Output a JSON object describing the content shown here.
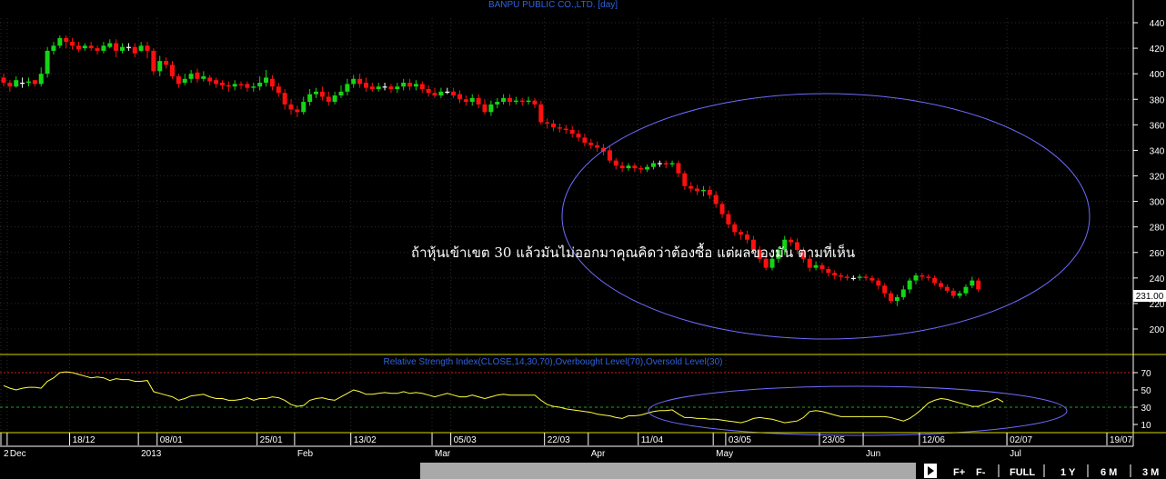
{
  "chart_data": {
    "type": "candlestick",
    "title": "BANPU PUBLIC CO.,LTD. [day]",
    "y_ticks": [
      200,
      220,
      240,
      260,
      280,
      300,
      320,
      340,
      360,
      380,
      400,
      420,
      440
    ],
    "ylim": [
      185,
      452
    ],
    "last_price": "231.00",
    "colors": {
      "up": "#16d416",
      "down": "#ff1010",
      "doji": "#ffffff"
    },
    "candles": [
      [
        397,
        393,
        400,
        390
      ],
      [
        393,
        390,
        395,
        386
      ],
      [
        390,
        395,
        398,
        389
      ],
      [
        393,
        393,
        397,
        389
      ],
      [
        393,
        394,
        397,
        390
      ],
      [
        395,
        392,
        395,
        390
      ],
      [
        392,
        400,
        405,
        390
      ],
      [
        400,
        418,
        421,
        397
      ],
      [
        418,
        422,
        425,
        415
      ],
      [
        422,
        428,
        430,
        420
      ],
      [
        428,
        425,
        430,
        420
      ],
      [
        425,
        422,
        428,
        419
      ],
      [
        422,
        419,
        425,
        417
      ],
      [
        420,
        422,
        424,
        418
      ],
      [
        422,
        420,
        425,
        418
      ],
      [
        420,
        418,
        422,
        415
      ],
      [
        418,
        422,
        425,
        416
      ],
      [
        421,
        424,
        427,
        420
      ],
      [
        424,
        418,
        427,
        413
      ],
      [
        418,
        421,
        424,
        416
      ],
      [
        421,
        421,
        424,
        418
      ],
      [
        421,
        416,
        424,
        413
      ],
      [
        418,
        422,
        425,
        417
      ],
      [
        422,
        418,
        425,
        412
      ],
      [
        418,
        402,
        420,
        399
      ],
      [
        402,
        410,
        414,
        398
      ],
      [
        410,
        407,
        413,
        404
      ],
      [
        407,
        398,
        410,
        396
      ],
      [
        398,
        392,
        400,
        389
      ],
      [
        393,
        396,
        400,
        391
      ],
      [
        396,
        400,
        403,
        393
      ],
      [
        401,
        396,
        404,
        393
      ],
      [
        396,
        398,
        402,
        394
      ],
      [
        397,
        394,
        399,
        391
      ],
      [
        395,
        392,
        397,
        389
      ],
      [
        393,
        391,
        395,
        388
      ],
      [
        391,
        390,
        394,
        386
      ],
      [
        390,
        392,
        395,
        387
      ],
      [
        392,
        391,
        394,
        388
      ],
      [
        392,
        389,
        394,
        386
      ],
      [
        389,
        390,
        393,
        386
      ],
      [
        390,
        393,
        398,
        387
      ],
      [
        393,
        397,
        403,
        390
      ],
      [
        396,
        390,
        399,
        387
      ],
      [
        390,
        385,
        393,
        382
      ],
      [
        385,
        376,
        388,
        372
      ],
      [
        376,
        372,
        380,
        368
      ],
      [
        372,
        370,
        375,
        366
      ],
      [
        370,
        378,
        382,
        368
      ],
      [
        378,
        384,
        388,
        375
      ],
      [
        384,
        386,
        389,
        381
      ],
      [
        386,
        382,
        390,
        379
      ],
      [
        382,
        378,
        386,
        375
      ],
      [
        378,
        383,
        386,
        376
      ],
      [
        383,
        386,
        391,
        381
      ],
      [
        386,
        392,
        396,
        383
      ],
      [
        392,
        396,
        399,
        389
      ],
      [
        396,
        392,
        400,
        389
      ],
      [
        393,
        389,
        397,
        386
      ],
      [
        390,
        388,
        393,
        386
      ],
      [
        388,
        390,
        393,
        386
      ],
      [
        390,
        390,
        393,
        387
      ],
      [
        390,
        388,
        392,
        385
      ],
      [
        388,
        390,
        393,
        385
      ],
      [
        390,
        393,
        396,
        387
      ],
      [
        393,
        390,
        396,
        387
      ],
      [
        390,
        392,
        395,
        387
      ],
      [
        392,
        388,
        394,
        385
      ],
      [
        388,
        385,
        391,
        382
      ],
      [
        385,
        383,
        389,
        381
      ],
      [
        383,
        386,
        389,
        381
      ],
      [
        386,
        386,
        389,
        384
      ],
      [
        386,
        383,
        389,
        381
      ],
      [
        384,
        380,
        387,
        377
      ],
      [
        380,
        378,
        383,
        375
      ],
      [
        378,
        381,
        384,
        375
      ],
      [
        381,
        376,
        384,
        373
      ],
      [
        376,
        370,
        380,
        368
      ],
      [
        370,
        376,
        379,
        367
      ],
      [
        376,
        378,
        381,
        373
      ],
      [
        378,
        381,
        384,
        376
      ],
      [
        381,
        378,
        384,
        375
      ],
      [
        378,
        379,
        382,
        376
      ],
      [
        379,
        378,
        381,
        375
      ],
      [
        378,
        379,
        382,
        376
      ],
      [
        379,
        376,
        381,
        373
      ],
      [
        376,
        362,
        379,
        360
      ],
      [
        362,
        361,
        365,
        357
      ],
      [
        361,
        358,
        364,
        355
      ],
      [
        358,
        357,
        361,
        354
      ],
      [
        357,
        356,
        360,
        353
      ],
      [
        356,
        353,
        359,
        350
      ],
      [
        353,
        350,
        356,
        347
      ],
      [
        350,
        346,
        353,
        343
      ],
      [
        346,
        344,
        349,
        341
      ],
      [
        344,
        342,
        347,
        339
      ],
      [
        342,
        339,
        345,
        336
      ],
      [
        340,
        332,
        343,
        330
      ],
      [
        332,
        328,
        334,
        325
      ],
      [
        328,
        326,
        331,
        323
      ],
      [
        326,
        328,
        330,
        324
      ],
      [
        328,
        326,
        330,
        323
      ],
      [
        326,
        325,
        328,
        322
      ],
      [
        325,
        327,
        329,
        323
      ],
      [
        327,
        330,
        332,
        325
      ],
      [
        330,
        330,
        332,
        327
      ],
      [
        330,
        329,
        332,
        326
      ],
      [
        329,
        330,
        332,
        327
      ],
      [
        330,
        322,
        332,
        319
      ],
      [
        322,
        312,
        324,
        309
      ],
      [
        312,
        310,
        315,
        307
      ],
      [
        310,
        308,
        313,
        305
      ],
      [
        308,
        309,
        312,
        304
      ],
      [
        309,
        305,
        312,
        302
      ],
      [
        305,
        298,
        308,
        295
      ],
      [
        298,
        290,
        300,
        287
      ],
      [
        290,
        282,
        293,
        279
      ],
      [
        282,
        276,
        284,
        273
      ],
      [
        276,
        274,
        278,
        270
      ],
      [
        274,
        270,
        277,
        267
      ],
      [
        270,
        262,
        273,
        259
      ],
      [
        262,
        255,
        265,
        252
      ],
      [
        255,
        248,
        258,
        246
      ],
      [
        248,
        255,
        258,
        246
      ],
      [
        255,
        262,
        264,
        252
      ],
      [
        262,
        270,
        273,
        258
      ],
      [
        270,
        268,
        272,
        265
      ],
      [
        268,
        262,
        271,
        259
      ],
      [
        262,
        255,
        264,
        252
      ],
      [
        255,
        248,
        258,
        245
      ],
      [
        248,
        250,
        253,
        246
      ],
      [
        250,
        247,
        252,
        244
      ],
      [
        247,
        244,
        249,
        241
      ],
      [
        244,
        242,
        246,
        239
      ],
      [
        242,
        241,
        244,
        238
      ],
      [
        241,
        240,
        243,
        238
      ],
      [
        240,
        240,
        242,
        238
      ],
      [
        240,
        241,
        243,
        238
      ],
      [
        241,
        240,
        243,
        238
      ],
      [
        240,
        238,
        242,
        236
      ],
      [
        238,
        234,
        240,
        231
      ],
      [
        234,
        228,
        236,
        225
      ],
      [
        228,
        222,
        230,
        220
      ],
      [
        222,
        225,
        227,
        218
      ],
      [
        225,
        231,
        234,
        223
      ],
      [
        231,
        238,
        240,
        228
      ],
      [
        238,
        242,
        244,
        235
      ],
      [
        242,
        241,
        244,
        238
      ],
      [
        241,
        240,
        243,
        238
      ],
      [
        240,
        236,
        242,
        234
      ],
      [
        236,
        233,
        238,
        231
      ],
      [
        233,
        230,
        235,
        228
      ],
      [
        230,
        226,
        232,
        224
      ],
      [
        226,
        228,
        230,
        224
      ],
      [
        228,
        233,
        235,
        226
      ],
      [
        234,
        238,
        241,
        232
      ],
      [
        238,
        231,
        240,
        229
      ]
    ],
    "date_labels": [
      {
        "i": 0,
        "text": "2"
      },
      {
        "i": 1,
        "text": "Dec"
      },
      {
        "i": 11,
        "text": "18/12"
      },
      {
        "i": 22,
        "text": "2013"
      },
      {
        "i": 25,
        "text": "08/01"
      },
      {
        "i": 41,
        "text": "25/01"
      },
      {
        "i": 47,
        "text": "Feb"
      },
      {
        "i": 56,
        "text": "13/02"
      },
      {
        "i": 69,
        "text": "Mar"
      },
      {
        "i": 72,
        "text": "05/03"
      },
      {
        "i": 87,
        "text": "22/03"
      },
      {
        "i": 94,
        "text": "Apr"
      },
      {
        "i": 102,
        "text": "11/04"
      },
      {
        "i": 114,
        "text": "May"
      },
      {
        "i": 116,
        "text": "03/05"
      },
      {
        "i": 131,
        "text": "23/05"
      },
      {
        "i": 138,
        "text": "Jun"
      },
      {
        "i": 147,
        "text": "12/06"
      },
      {
        "i": 161,
        "text": "Jul"
      },
      {
        "i": 161,
        "text": "02/07"
      },
      {
        "i": 177,
        "text": "19/07"
      }
    ],
    "annotation": "ถ้าหุ้นเข้าเขต 30 แล้วมันไม่ออกมาคุณคิดว่าต้องซื้อ แต่ผลของมัน ตามที่เห็น",
    "rsi": {
      "title": "Relative Strength Index(CLOSE,14,30,70),Overbought Level(70),Oversold Level(30)",
      "ticks": [
        10,
        30,
        50,
        70
      ],
      "ylim": [
        0,
        85
      ],
      "overbought": 70,
      "oversold": 30,
      "line_color": "#ffff40",
      "values": [
        55,
        52,
        50,
        52,
        53,
        53,
        52,
        60,
        64,
        70,
        71,
        70,
        68,
        66,
        64,
        65,
        64,
        61,
        63,
        62,
        62,
        60,
        60,
        61,
        48,
        46,
        44,
        42,
        38,
        40,
        43,
        44,
        45,
        42,
        40,
        40,
        38,
        38,
        39,
        41,
        38,
        40,
        40,
        42,
        41,
        38,
        33,
        31,
        32,
        38,
        40,
        41,
        39,
        38,
        42,
        46,
        50,
        48,
        45,
        45,
        46,
        47,
        46,
        46,
        48,
        46,
        47,
        46,
        44,
        42,
        44,
        46,
        44,
        42,
        42,
        44,
        42,
        40,
        42,
        44,
        45,
        44,
        44,
        44,
        44,
        44,
        38,
        33,
        31,
        30,
        28,
        27,
        26,
        25,
        24,
        22,
        21,
        20,
        18,
        17,
        20,
        20,
        21,
        23,
        25,
        26,
        26,
        27,
        22,
        18,
        18,
        17,
        17,
        16,
        16,
        15,
        14,
        13,
        12,
        14,
        17,
        18,
        17,
        16,
        14,
        12,
        13,
        14,
        18,
        25,
        26,
        25,
        23,
        21,
        19,
        19,
        19,
        19,
        19,
        19,
        19,
        19,
        18,
        16,
        14,
        17,
        22,
        28,
        35,
        38,
        40,
        39,
        37,
        35,
        33,
        31,
        31,
        34,
        37,
        40,
        36
      ]
    }
  },
  "toolbar": {
    "buttons": [
      "FULL",
      "1 Y",
      "6 M",
      "3 M"
    ],
    "f_plus": "F+",
    "f_minus": "F-"
  }
}
